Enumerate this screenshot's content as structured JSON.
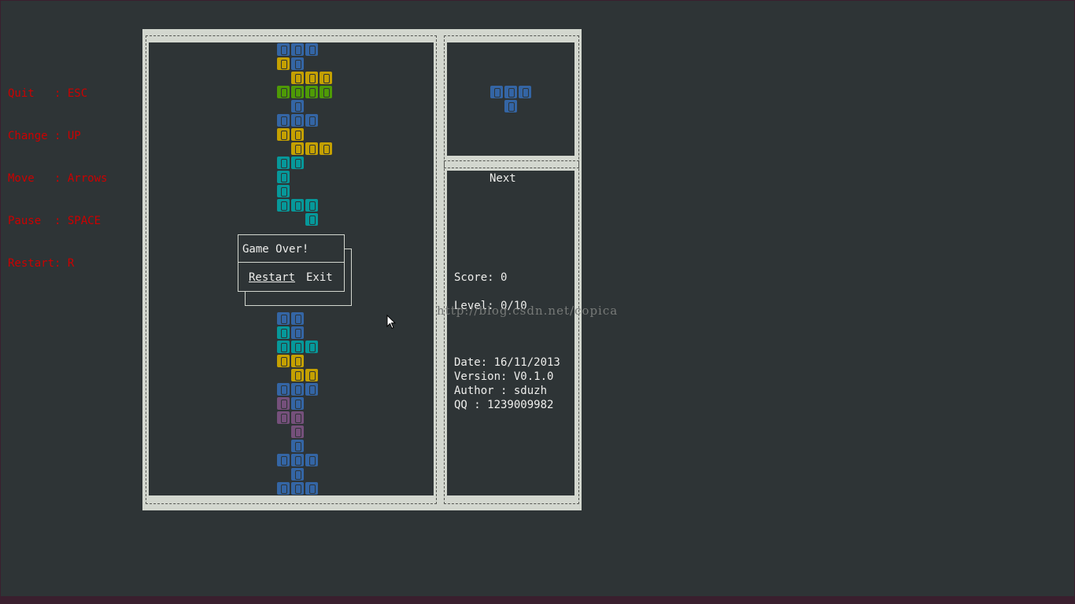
{
  "help": {
    "lines": [
      "Quit   : ESC",
      "Change : UP",
      "Move   : Arrows",
      "Pause  : SPACE",
      "Restart: R"
    ]
  },
  "next_label": "Next",
  "score_text": "Score: 0",
  "level_text": "Level: 0/10",
  "info": {
    "date": "Date: 16/11/2013",
    "version": "Version: V0.1.0",
    "author": "Author : sduzh",
    "qq": "QQ : 1239009982"
  },
  "dialog": {
    "title": "Game Over!",
    "restart_label": "Restart",
    "exit_label": "Exit"
  },
  "watermark": "http://blog.csdn.net/copica",
  "colors": {
    "blue": "#3465a4",
    "yellow": "#c4a000",
    "green": "#4e9a06",
    "cyan": "#06989a",
    "purple": "#75507b",
    "help_text": "#cc0000"
  },
  "board": {
    "columns": 20,
    "rows": 32,
    "cells": [
      [
        0,
        9,
        "blue"
      ],
      [
        0,
        10,
        "blue"
      ],
      [
        0,
        11,
        "blue"
      ],
      [
        1,
        9,
        "yellow"
      ],
      [
        1,
        10,
        "blue"
      ],
      [
        2,
        10,
        "yellow"
      ],
      [
        2,
        11,
        "yellow"
      ],
      [
        2,
        12,
        "yellow"
      ],
      [
        3,
        9,
        "green"
      ],
      [
        3,
        10,
        "green"
      ],
      [
        3,
        11,
        "green"
      ],
      [
        3,
        12,
        "green"
      ],
      [
        4,
        10,
        "blue"
      ],
      [
        5,
        9,
        "blue"
      ],
      [
        5,
        10,
        "blue"
      ],
      [
        5,
        11,
        "blue"
      ],
      [
        6,
        9,
        "yellow"
      ],
      [
        6,
        10,
        "yellow"
      ],
      [
        7,
        10,
        "yellow"
      ],
      [
        7,
        11,
        "yellow"
      ],
      [
        7,
        12,
        "yellow"
      ],
      [
        8,
        9,
        "cyan"
      ],
      [
        8,
        10,
        "cyan"
      ],
      [
        9,
        9,
        "cyan"
      ],
      [
        10,
        9,
        "cyan"
      ],
      [
        11,
        9,
        "cyan"
      ],
      [
        11,
        10,
        "cyan"
      ],
      [
        11,
        11,
        "cyan"
      ],
      [
        12,
        11,
        "cyan"
      ],
      [
        19,
        9,
        "blue"
      ],
      [
        19,
        10,
        "blue"
      ],
      [
        20,
        9,
        "cyan"
      ],
      [
        20,
        10,
        "blue"
      ],
      [
        21,
        9,
        "cyan"
      ],
      [
        21,
        10,
        "cyan"
      ],
      [
        21,
        11,
        "cyan"
      ],
      [
        22,
        9,
        "yellow"
      ],
      [
        22,
        10,
        "yellow"
      ],
      [
        23,
        10,
        "yellow"
      ],
      [
        23,
        11,
        "yellow"
      ],
      [
        24,
        9,
        "blue"
      ],
      [
        24,
        10,
        "blue"
      ],
      [
        24,
        11,
        "blue"
      ],
      [
        25,
        9,
        "purple"
      ],
      [
        25,
        10,
        "blue"
      ],
      [
        26,
        9,
        "purple"
      ],
      [
        26,
        10,
        "purple"
      ],
      [
        27,
        10,
        "purple"
      ],
      [
        28,
        10,
        "blue"
      ],
      [
        29,
        9,
        "blue"
      ],
      [
        29,
        10,
        "blue"
      ],
      [
        29,
        11,
        "blue"
      ],
      [
        30,
        10,
        "blue"
      ],
      [
        31,
        9,
        "blue"
      ],
      [
        31,
        10,
        "blue"
      ],
      [
        31,
        11,
        "blue"
      ]
    ]
  },
  "next_piece": {
    "cells": [
      [
        0,
        0,
        "blue"
      ],
      [
        0,
        1,
        "blue"
      ],
      [
        0,
        2,
        "blue"
      ],
      [
        1,
        1,
        "blue"
      ]
    ]
  }
}
